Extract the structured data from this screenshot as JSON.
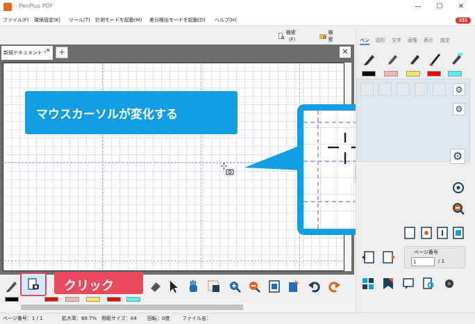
{
  "window": {
    "title": "- PenPlus PDF",
    "minimize": "—",
    "maximize": "☐",
    "close": "✕"
  },
  "menu": [
    "ファイル(F)",
    "環境設定(K)",
    "ツール(T)",
    "計測モードを起動(M)",
    "差分検出モードを起動(D)",
    "ヘルプ(H)"
  ],
  "badge": "331",
  "search": {
    "btn1": "検索（F）",
    "btn2": "検索"
  },
  "tabs": {
    "doc_tab": "新規ドキュメント *",
    "tab_close": "✕",
    "add": "+",
    "doc_close": "✕"
  },
  "callout": {
    "text": "マウスカーソルが変化する"
  },
  "click_label": "クリック",
  "right_panel": {
    "tabs": [
      "ペン",
      "図形",
      "文字",
      "画像",
      "表示",
      "設定"
    ],
    "swatch_colors": [
      "#000000",
      "#f4b5ae",
      "#f1ea5a",
      "#e01010",
      "#4ff0f0"
    ],
    "page_label": "ページ番号",
    "page_value": "1",
    "page_total": "/ 1"
  },
  "bottom_swatches": [
    "#000000",
    "#f4b5ae",
    "#f1ea5a",
    "#e01010",
    "#4ff0f0"
  ],
  "status": {
    "page": "ページ番号：1 / 1",
    "zoom": "拡大率：88.7%",
    "paper": "用紙サイズ：A4",
    "rotation": "回転：0度",
    "filename": "ファイル名："
  },
  "icons": [
    "search-icon",
    "search-folder-icon",
    "pen-icon",
    "brush-icon",
    "eraser-icon",
    "arrow-cursor-icon",
    "hand-icon",
    "zoom-in-icon",
    "zoom-out-icon",
    "gear-icon",
    "undo-icon",
    "redo-icon",
    "capture-icon",
    "camera-icon"
  ]
}
